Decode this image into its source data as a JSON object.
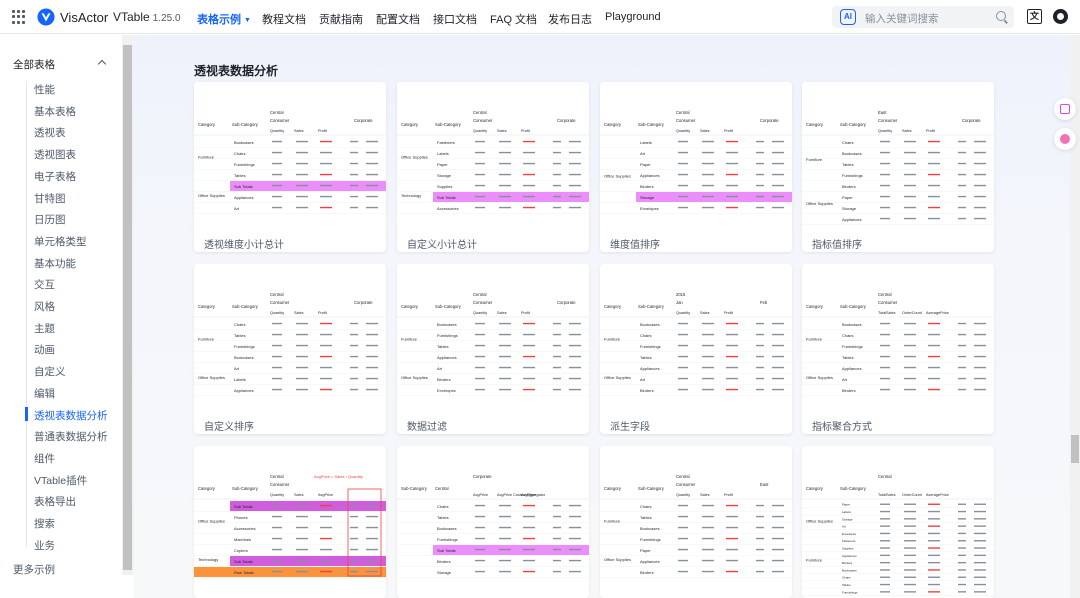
{
  "header": {
    "brand": "VisActor",
    "product": "VTable",
    "version": "1.25.0",
    "nav": [
      {
        "label": "表格示例",
        "active": true,
        "caret": "▼"
      },
      {
        "label": "教程文档"
      },
      {
        "label": "贡献指南"
      },
      {
        "label": "配置文档"
      },
      {
        "label": "接口文档"
      },
      {
        "label": "FAQ 文档"
      },
      {
        "label": "发布日志"
      },
      {
        "label": "Playground"
      }
    ],
    "search": {
      "ai_label": "AI",
      "placeholder": "输入关键词搜索"
    },
    "lang_label": "文"
  },
  "sidebar": {
    "group": "全部表格",
    "items": [
      "性能",
      "基本表格",
      "透视表",
      "透视图表",
      "电子表格",
      "甘特图",
      "日历图",
      "单元格类型",
      "基本功能",
      "交互",
      "风格",
      "主题",
      "动画",
      "自定义",
      "编辑",
      "透视表数据分析",
      "普通表数据分析",
      "组件",
      "VTable插件",
      "表格导出",
      "搜索",
      "业务"
    ],
    "active_index": 15,
    "more": "更多示例"
  },
  "main": {
    "section_title": "透视表数据分析",
    "cards": [
      {
        "label": "透视维度小计总计"
      },
      {
        "label": "自定义小计总计"
      },
      {
        "label": "维度值排序"
      },
      {
        "label": "指标值排序"
      },
      {
        "label": "自定义排序"
      },
      {
        "label": "数据过滤"
      },
      {
        "label": "派生字段"
      },
      {
        "label": "指标聚合方式"
      },
      {
        "label": ""
      },
      {
        "label": ""
      },
      {
        "label": ""
      },
      {
        "label": ""
      }
    ]
  },
  "thumbs": [
    {
      "h": [
        "Category",
        "Sub-Category",
        "Central",
        "Consumer",
        "Corporate",
        "Quantity",
        "Sales",
        "Profit"
      ],
      "rows": [
        "Bookcases",
        "Chairs",
        "Furnishings",
        "Tables",
        "Sub Totals",
        "Appliances",
        "Art"
      ],
      "left": [
        "Furniture",
        "Office Supplies"
      ],
      "hl": 4
    },
    {
      "h": [
        "Category",
        "Sub-Category",
        "Central",
        "Consumer",
        "Corporate",
        "Quantity",
        "Sales",
        "Profit"
      ],
      "rows": [
        "Fasteners",
        "Labels",
        "Paper",
        "Storage",
        "Supplies",
        "Sub Totals",
        "Accessories"
      ],
      "left": [
        "Office Supplies",
        "Technology"
      ],
      "hl": 5
    },
    {
      "h": [
        "Category",
        "Sub-Category",
        "Central",
        "Consumer",
        "Corporate",
        "Quantity",
        "Sales",
        "Profit"
      ],
      "rows": [
        "Labels",
        "Art",
        "Paper",
        "Appliances",
        "Binders",
        "Storage",
        "Envelopes"
      ],
      "left": [
        "Office Supplies"
      ],
      "hl": 5
    },
    {
      "h": [
        "Category",
        "Sub-Category",
        "East",
        "Consumer",
        "Corporate",
        "Quantity",
        "Sales",
        "Profit"
      ],
      "rows": [
        "Chairs",
        "Bookcases",
        "Tables",
        "Furnishings",
        "Binders",
        "Paper",
        "Storage",
        "Appliances"
      ],
      "left": [
        "Furniture",
        "Office Supplies"
      ],
      "hl": -1
    },
    {
      "h": [
        "Category",
        "Sub-Category",
        "Central",
        "Consumer",
        "Corporate",
        "Quantity",
        "Sales",
        "Profit"
      ],
      "rows": [
        "Chairs",
        "Tables",
        "Furnishings",
        "Bookcases",
        "Art",
        "Labels",
        "Appliances"
      ],
      "left": [
        "Furniture",
        "Office Supplies"
      ],
      "hl": -1
    },
    {
      "h": [
        "Category",
        "Sub-Category",
        "Central",
        "Consumer",
        "Corporate",
        "Quantity",
        "Sales",
        "Profit"
      ],
      "rows": [
        "Bookcases",
        "Furnishings",
        "Tables",
        "Appliances",
        "Art",
        "Binders",
        "Envelopes"
      ],
      "left": [
        "Furniture",
        "Office Supplies"
      ],
      "hl": -1
    },
    {
      "h": [
        "Category",
        "Sub-Category",
        "2015",
        "Jan",
        "Feb",
        "Quantity",
        "Sales",
        "Profit"
      ],
      "rows": [
        "Bookcases",
        "Chairs",
        "Furnishings",
        "Tables",
        "Appliances",
        "Art",
        "Binders"
      ],
      "left": [
        "Furniture",
        "Office Supplies"
      ],
      "hl": -1
    },
    {
      "h": [
        "Category",
        "Sub-Category",
        "Central",
        "Consumer",
        "",
        "TotalSales",
        "OrderCount",
        "AveragePrice"
      ],
      "rows": [
        "Bookcases",
        "Chairs",
        "Furnishings",
        "Tables",
        "Appliances",
        "Art",
        "Binders"
      ],
      "left": [
        "Furniture",
        "Office Supplies"
      ],
      "hl": -1
    },
    {
      "h": [
        "Category",
        "Sub-Category",
        "Central",
        "Consumer",
        "",
        "Quantity",
        "Sales",
        "AvgPrice"
      ],
      "rows": [
        "Sub Totals",
        "Phones",
        "Accessories",
        "Machines",
        "Copiers",
        "Sub Totals",
        "Row Totals"
      ],
      "left": [
        "Office Supplies",
        "Technology"
      ],
      "hl": 0,
      "anno": "AvgPrice = Sales / Quantity"
    },
    {
      "h": [
        "Sub-Category",
        "Central",
        "Corporate",
        "",
        "",
        "AvgPrice",
        "AvgPrice CustomAggregator",
        "AvgPrice"
      ],
      "rows": [
        "Chairs",
        "Tables",
        "Bookcases",
        "Furnishings",
        "Sub Totals",
        "Binders",
        "Storage"
      ],
      "left": [],
      "hl": 4
    },
    {
      "h": [
        "Category",
        "Sub-Category",
        "Central",
        "Consumer",
        "East",
        "Quantity",
        "Sales",
        "Profit"
      ],
      "rows": [
        "Chairs",
        "Tables",
        "Bookcases",
        "Furnishings",
        "Paper",
        "Appliances",
        "Binders"
      ],
      "left": [
        "Furniture",
        "Office Supplies"
      ],
      "hl": -1
    },
    {
      "h": [
        "Category",
        "Sub-Category",
        "Central",
        "",
        "",
        "TotalSales",
        "OrderCount",
        "AveragePrice"
      ],
      "rows": [
        "Paper",
        "Labels",
        "Storage",
        "Art",
        "Envelopes",
        "Fasteners",
        "Supplies",
        "Appliances",
        "Binders",
        "Bookcases",
        "Chairs",
        "Tables",
        "Furnishings",
        "Phones",
        "Accessories",
        "Copiers"
      ],
      "left": [
        "Office Supplies",
        "Furniture",
        "Technology"
      ],
      "hl": -1
    }
  ]
}
